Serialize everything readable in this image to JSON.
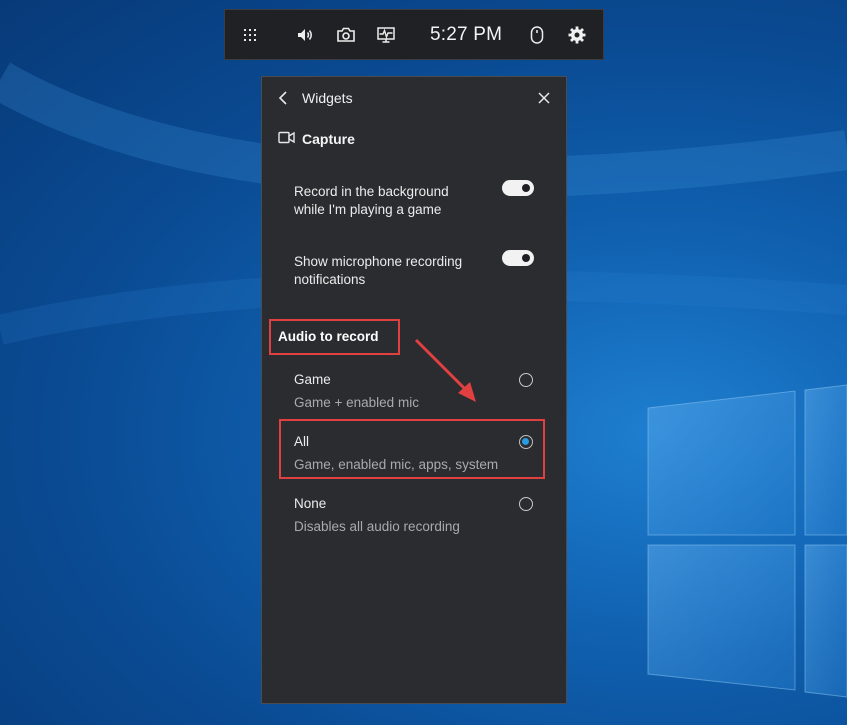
{
  "topbar": {
    "widgets_icon": "grid-icon",
    "audio_icon": "speaker-icon",
    "capture_icon": "camera-icon",
    "performance_icon": "monitor-performance-icon",
    "time": "5:27 PM",
    "mouse_icon": "mouse-icon",
    "settings_icon": "gear-icon"
  },
  "panel": {
    "back_label": "Widgets",
    "section": {
      "title": "Capture",
      "icon": "video-camera-icon"
    },
    "toggles": [
      {
        "label_line1": "Record in the background",
        "label_line2": "while I'm playing a game",
        "state": "on"
      },
      {
        "label_line1": "Show microphone recording",
        "label_line2": "notifications",
        "state": "on"
      }
    ],
    "audio_section_label": "Audio to record",
    "audio_options": [
      {
        "title": "Game",
        "subtitle": "Game + enabled mic",
        "selected": false
      },
      {
        "title": "All",
        "subtitle": "Game, enabled mic, apps, system",
        "selected": true
      },
      {
        "title": "None",
        "subtitle": "Disables all audio recording",
        "selected": false
      }
    ]
  },
  "colors": {
    "accent": "#2a9be0",
    "annotation": "#e0403f",
    "panel_bg": "#2b2c30",
    "bar_bg": "#1f2125"
  }
}
